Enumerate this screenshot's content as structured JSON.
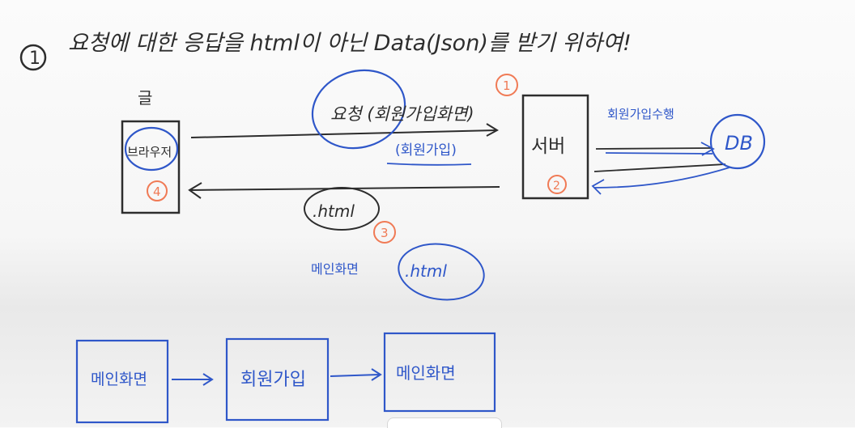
{
  "heading": {
    "number": "1",
    "text": "요청에 대한 응답을 html이 아닌 Data(Json)를 받기 위하여!"
  },
  "nodes": {
    "user_label": "글",
    "browser": "브라우저",
    "server": "서버",
    "db": "DB"
  },
  "steps": [
    "1",
    "2",
    "3",
    "4"
  ],
  "labels": {
    "request": "요청 (회원가입화면)",
    "request_sub": "(회원가입)",
    "db_action": "회원가입수행",
    "response_file": ".html",
    "main_screen": "메인화면",
    "main_file": ".html"
  },
  "flow": [
    "메인화면",
    "회원가입",
    "메인화면"
  ],
  "colors": {
    "ink": "#2d2d2d",
    "blue": "#2f57c9",
    "red": "#f07a55"
  }
}
